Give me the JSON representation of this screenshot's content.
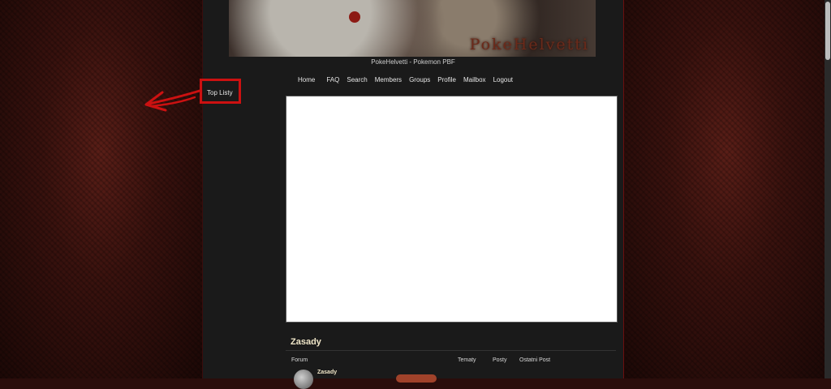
{
  "header": {
    "banner_title": "PokeHelvetti",
    "site_subtitle": "PokeHelvetti - Pokemon PBF"
  },
  "nav": {
    "items": [
      "Home",
      "FAQ",
      "Search",
      "Members",
      "Groups",
      "Profile",
      "Mailbox",
      "Logout"
    ]
  },
  "sidebar": {
    "link_label": "Top Listy"
  },
  "forum": {
    "section_title": "Zasady",
    "columns": [
      "Forum",
      "Tematy",
      "Posty",
      "Ostatni Post"
    ],
    "rows": [
      {
        "title": "Zasady"
      }
    ]
  },
  "annotation": {
    "color": "#cc1111"
  }
}
